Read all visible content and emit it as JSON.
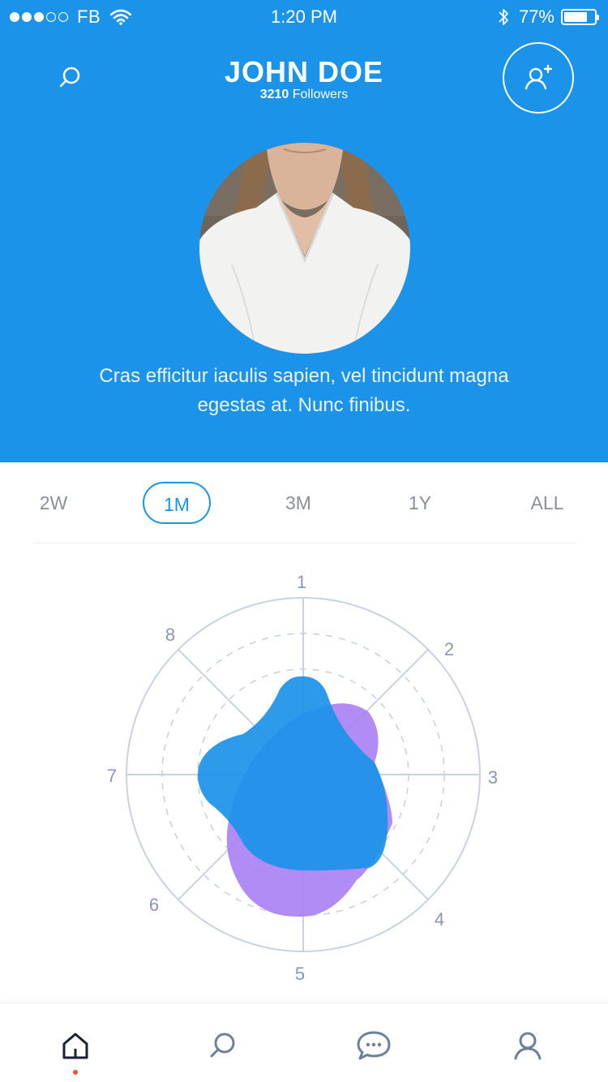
{
  "status_bar": {
    "carrier": "FB",
    "time": "1:20 PM",
    "battery_percent": "77%",
    "battery_level": 0.77,
    "signal_bars_filled": 3,
    "signal_bars_total": 5
  },
  "header": {
    "name": "JOHN DOE",
    "followers_count": "3210",
    "followers_label": "Followers",
    "bio": "Cras efficitur iaculis sapien, vel tincidunt magna egestas at. Nunc finibus.",
    "background_color": "#1b93e8"
  },
  "icons": {
    "search": "search-icon",
    "add_user": "add-user-icon",
    "home": "home-icon",
    "chat": "chat-icon",
    "profile": "profile-icon"
  },
  "range_tabs": [
    {
      "label": "2W",
      "active": false
    },
    {
      "label": "1M",
      "active": true
    },
    {
      "label": "3M",
      "active": false
    },
    {
      "label": "1Y",
      "active": false
    },
    {
      "label": "ALL",
      "active": false
    }
  ],
  "chart_data": {
    "type": "radar",
    "axes": [
      "1",
      "2",
      "3",
      "4",
      "5",
      "6",
      "7",
      "8"
    ],
    "series_colors": [
      "#1b93e8",
      "#a57cf2"
    ]
  },
  "colors": {
    "accent": "#1b93e8",
    "secondary": "#a57cf2",
    "active_indicator": "#f2552c",
    "grid": "#c9d2e0"
  }
}
